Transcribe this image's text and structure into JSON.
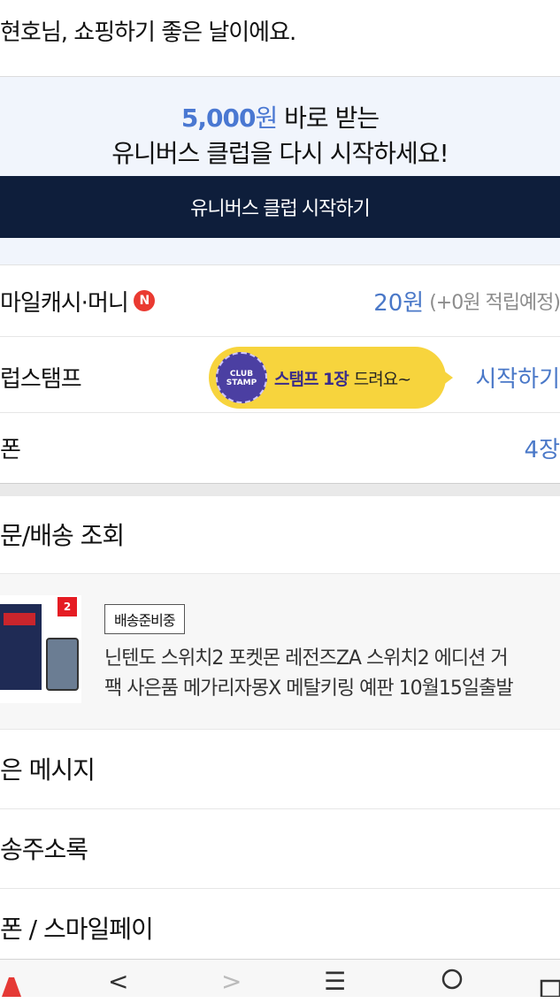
{
  "greeting": "현호님, 쇼핑하기 좋은 날이에요.",
  "promo": {
    "amount": "5,000",
    "amount_unit": "원",
    "line1_rest": " 바로 받는",
    "line2": "유니버스 클럽을 다시 시작하세요!",
    "button_label": "유니버스 클럽 시작하기"
  },
  "wallet": {
    "label": "마일캐시·머니",
    "badge": "N",
    "value": "20원",
    "sub": "(+0원 적립예정)"
  },
  "stamp": {
    "label": "럽스탬프",
    "stamp_text": "CLUB STAMP",
    "bubble_strong": "스탬프 1장",
    "bubble_rest": "드려요~",
    "action": "시작하기"
  },
  "coupon": {
    "label": "폰",
    "value": "4장"
  },
  "orders": {
    "title": "문/배송 조회",
    "item": {
      "status": "배송준비중",
      "title_line1": "닌텐도 스위치2 포켓몬 레전즈ZA 스위치2 에디션 거",
      "title_line2": "팩 사은품 메가리자몽X 메탈키링 예판 10월15일출발",
      "thumb_badge": "2"
    }
  },
  "menu": [
    {
      "label": "은 메시지"
    },
    {
      "label": "송주소록"
    },
    {
      "label": "폰 / 스마일페이"
    }
  ],
  "bottom_nav": {
    "back": "<",
    "forward": ">",
    "menu": "☰"
  },
  "colors": {
    "accent": "#4a78d2",
    "navy": "#0e1e3b",
    "promo_bg": "#f1f5fc",
    "bubble": "#f7d43d",
    "badge_red": "#ea3a31"
  }
}
